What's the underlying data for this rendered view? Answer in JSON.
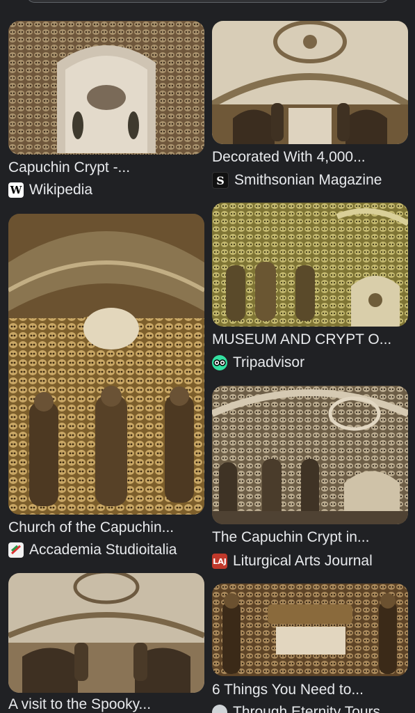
{
  "results": [
    {
      "title": "Capuchin Crypt -...",
      "source": "Wikipedia",
      "favicon": "wikipedia-icon",
      "favicon_glyph": "W",
      "colors": [
        "#8a6f4f",
        "#b9ab96",
        "#5c4631"
      ]
    },
    {
      "title": "Church of the Capuchin...",
      "source": "Accademia Studioitalia",
      "favicon": "accademia-icon",
      "favicon_glyph": "",
      "colors": [
        "#9a7a3e",
        "#c9ad74",
        "#5d4420"
      ]
    },
    {
      "title": "A visit to the Spooky...",
      "source": "",
      "favicon": "",
      "favicon_glyph": "",
      "colors": [
        "#b7a991",
        "#d9d2c4",
        "#6a563c"
      ]
    },
    {
      "title": "Decorated With 4,000...",
      "source": "Smithsonian Magazine",
      "favicon": "smithsonian-icon",
      "favicon_glyph": "S",
      "colors": [
        "#c6b79c",
        "#e6dfd1",
        "#6d5536"
      ]
    },
    {
      "title": "MUSEUM AND CRYPT O...",
      "source": "Tripadvisor",
      "favicon": "tripadvisor-icon",
      "favicon_glyph": "",
      "colors": [
        "#a99d52",
        "#d2c98c",
        "#5d5426"
      ]
    },
    {
      "title": "The Capuchin Crypt in...",
      "source": "Liturgical Arts Journal",
      "favicon": "liturgical-arts-icon",
      "favicon_glyph": "LAJ",
      "colors": [
        "#8f7e63",
        "#c7baa3",
        "#4f4231"
      ]
    },
    {
      "title": "6 Things You Need to...",
      "source": "Through Eternity Tours",
      "favicon": "through-eternity-icon",
      "favicon_glyph": "",
      "colors": [
        "#8d6f45",
        "#cbb78f",
        "#4f3920"
      ]
    }
  ]
}
